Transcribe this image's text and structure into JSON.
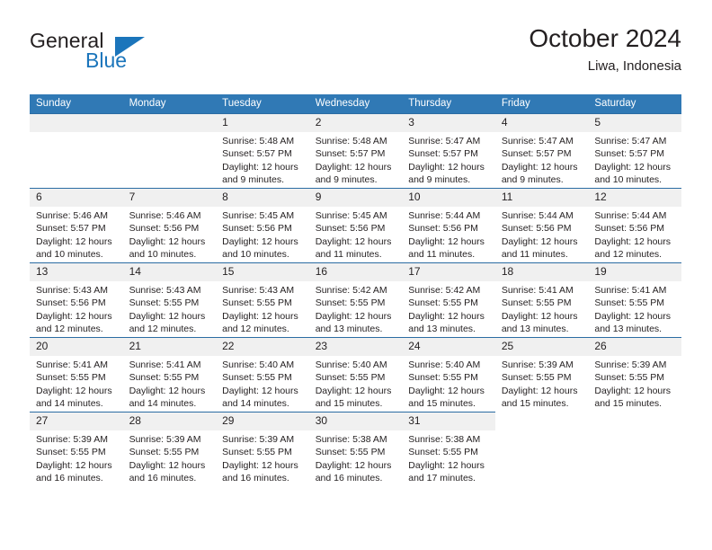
{
  "brand": {
    "name_part1": "General",
    "name_part2": "Blue",
    "triangle_color": "#1b75bb"
  },
  "header": {
    "title": "October 2024",
    "subtitle": "Liwa, Indonesia"
  },
  "theme": {
    "header_row_bg": "#3079b5",
    "row_border": "#2b6ca3",
    "daynum_bg": "#f0f0f0",
    "text": "#231f20"
  },
  "weekday_headers": [
    "Sunday",
    "Monday",
    "Tuesday",
    "Wednesday",
    "Thursday",
    "Friday",
    "Saturday"
  ],
  "labels": {
    "sunrise_prefix": "Sunrise:",
    "sunset_prefix": "Sunset:",
    "daylight_prefix": "Daylight:"
  },
  "weeks": [
    [
      {
        "day": "",
        "sunrise": "",
        "sunset": "",
        "daylight": "",
        "blank": true
      },
      {
        "day": "",
        "sunrise": "",
        "sunset": "",
        "daylight": "",
        "blank": true
      },
      {
        "day": "1",
        "sunrise": "Sunrise: 5:48 AM",
        "sunset": "Sunset: 5:57 PM",
        "daylight": "Daylight: 12 hours and 9 minutes.",
        "blank": false
      },
      {
        "day": "2",
        "sunrise": "Sunrise: 5:48 AM",
        "sunset": "Sunset: 5:57 PM",
        "daylight": "Daylight: 12 hours and 9 minutes.",
        "blank": false
      },
      {
        "day": "3",
        "sunrise": "Sunrise: 5:47 AM",
        "sunset": "Sunset: 5:57 PM",
        "daylight": "Daylight: 12 hours and 9 minutes.",
        "blank": false
      },
      {
        "day": "4",
        "sunrise": "Sunrise: 5:47 AM",
        "sunset": "Sunset: 5:57 PM",
        "daylight": "Daylight: 12 hours and 9 minutes.",
        "blank": false
      },
      {
        "day": "5",
        "sunrise": "Sunrise: 5:47 AM",
        "sunset": "Sunset: 5:57 PM",
        "daylight": "Daylight: 12 hours and 10 minutes.",
        "blank": false
      }
    ],
    [
      {
        "day": "6",
        "sunrise": "Sunrise: 5:46 AM",
        "sunset": "Sunset: 5:57 PM",
        "daylight": "Daylight: 12 hours and 10 minutes.",
        "blank": false
      },
      {
        "day": "7",
        "sunrise": "Sunrise: 5:46 AM",
        "sunset": "Sunset: 5:56 PM",
        "daylight": "Daylight: 12 hours and 10 minutes.",
        "blank": false
      },
      {
        "day": "8",
        "sunrise": "Sunrise: 5:45 AM",
        "sunset": "Sunset: 5:56 PM",
        "daylight": "Daylight: 12 hours and 10 minutes.",
        "blank": false
      },
      {
        "day": "9",
        "sunrise": "Sunrise: 5:45 AM",
        "sunset": "Sunset: 5:56 PM",
        "daylight": "Daylight: 12 hours and 11 minutes.",
        "blank": false
      },
      {
        "day": "10",
        "sunrise": "Sunrise: 5:44 AM",
        "sunset": "Sunset: 5:56 PM",
        "daylight": "Daylight: 12 hours and 11 minutes.",
        "blank": false
      },
      {
        "day": "11",
        "sunrise": "Sunrise: 5:44 AM",
        "sunset": "Sunset: 5:56 PM",
        "daylight": "Daylight: 12 hours and 11 minutes.",
        "blank": false
      },
      {
        "day": "12",
        "sunrise": "Sunrise: 5:44 AM",
        "sunset": "Sunset: 5:56 PM",
        "daylight": "Daylight: 12 hours and 12 minutes.",
        "blank": false
      }
    ],
    [
      {
        "day": "13",
        "sunrise": "Sunrise: 5:43 AM",
        "sunset": "Sunset: 5:56 PM",
        "daylight": "Daylight: 12 hours and 12 minutes.",
        "blank": false
      },
      {
        "day": "14",
        "sunrise": "Sunrise: 5:43 AM",
        "sunset": "Sunset: 5:55 PM",
        "daylight": "Daylight: 12 hours and 12 minutes.",
        "blank": false
      },
      {
        "day": "15",
        "sunrise": "Sunrise: 5:43 AM",
        "sunset": "Sunset: 5:55 PM",
        "daylight": "Daylight: 12 hours and 12 minutes.",
        "blank": false
      },
      {
        "day": "16",
        "sunrise": "Sunrise: 5:42 AM",
        "sunset": "Sunset: 5:55 PM",
        "daylight": "Daylight: 12 hours and 13 minutes.",
        "blank": false
      },
      {
        "day": "17",
        "sunrise": "Sunrise: 5:42 AM",
        "sunset": "Sunset: 5:55 PM",
        "daylight": "Daylight: 12 hours and 13 minutes.",
        "blank": false
      },
      {
        "day": "18",
        "sunrise": "Sunrise: 5:41 AM",
        "sunset": "Sunset: 5:55 PM",
        "daylight": "Daylight: 12 hours and 13 minutes.",
        "blank": false
      },
      {
        "day": "19",
        "sunrise": "Sunrise: 5:41 AM",
        "sunset": "Sunset: 5:55 PM",
        "daylight": "Daylight: 12 hours and 13 minutes.",
        "blank": false
      }
    ],
    [
      {
        "day": "20",
        "sunrise": "Sunrise: 5:41 AM",
        "sunset": "Sunset: 5:55 PM",
        "daylight": "Daylight: 12 hours and 14 minutes.",
        "blank": false
      },
      {
        "day": "21",
        "sunrise": "Sunrise: 5:41 AM",
        "sunset": "Sunset: 5:55 PM",
        "daylight": "Daylight: 12 hours and 14 minutes.",
        "blank": false
      },
      {
        "day": "22",
        "sunrise": "Sunrise: 5:40 AM",
        "sunset": "Sunset: 5:55 PM",
        "daylight": "Daylight: 12 hours and 14 minutes.",
        "blank": false
      },
      {
        "day": "23",
        "sunrise": "Sunrise: 5:40 AM",
        "sunset": "Sunset: 5:55 PM",
        "daylight": "Daylight: 12 hours and 15 minutes.",
        "blank": false
      },
      {
        "day": "24",
        "sunrise": "Sunrise: 5:40 AM",
        "sunset": "Sunset: 5:55 PM",
        "daylight": "Daylight: 12 hours and 15 minutes.",
        "blank": false
      },
      {
        "day": "25",
        "sunrise": "Sunrise: 5:39 AM",
        "sunset": "Sunset: 5:55 PM",
        "daylight": "Daylight: 12 hours and 15 minutes.",
        "blank": false
      },
      {
        "day": "26",
        "sunrise": "Sunrise: 5:39 AM",
        "sunset": "Sunset: 5:55 PM",
        "daylight": "Daylight: 12 hours and 15 minutes.",
        "blank": false
      }
    ],
    [
      {
        "day": "27",
        "sunrise": "Sunrise: 5:39 AM",
        "sunset": "Sunset: 5:55 PM",
        "daylight": "Daylight: 12 hours and 16 minutes.",
        "blank": false
      },
      {
        "day": "28",
        "sunrise": "Sunrise: 5:39 AM",
        "sunset": "Sunset: 5:55 PM",
        "daylight": "Daylight: 12 hours and 16 minutes.",
        "blank": false
      },
      {
        "day": "29",
        "sunrise": "Sunrise: 5:39 AM",
        "sunset": "Sunset: 5:55 PM",
        "daylight": "Daylight: 12 hours and 16 minutes.",
        "blank": false
      },
      {
        "day": "30",
        "sunrise": "Sunrise: 5:38 AM",
        "sunset": "Sunset: 5:55 PM",
        "daylight": "Daylight: 12 hours and 16 minutes.",
        "blank": false
      },
      {
        "day": "31",
        "sunrise": "Sunrise: 5:38 AM",
        "sunset": "Sunset: 5:55 PM",
        "daylight": "Daylight: 12 hours and 17 minutes.",
        "blank": false
      },
      {
        "day": "",
        "sunrise": "",
        "sunset": "",
        "daylight": "",
        "blank": true
      },
      {
        "day": "",
        "sunrise": "",
        "sunset": "",
        "daylight": "",
        "blank": true
      }
    ]
  ]
}
